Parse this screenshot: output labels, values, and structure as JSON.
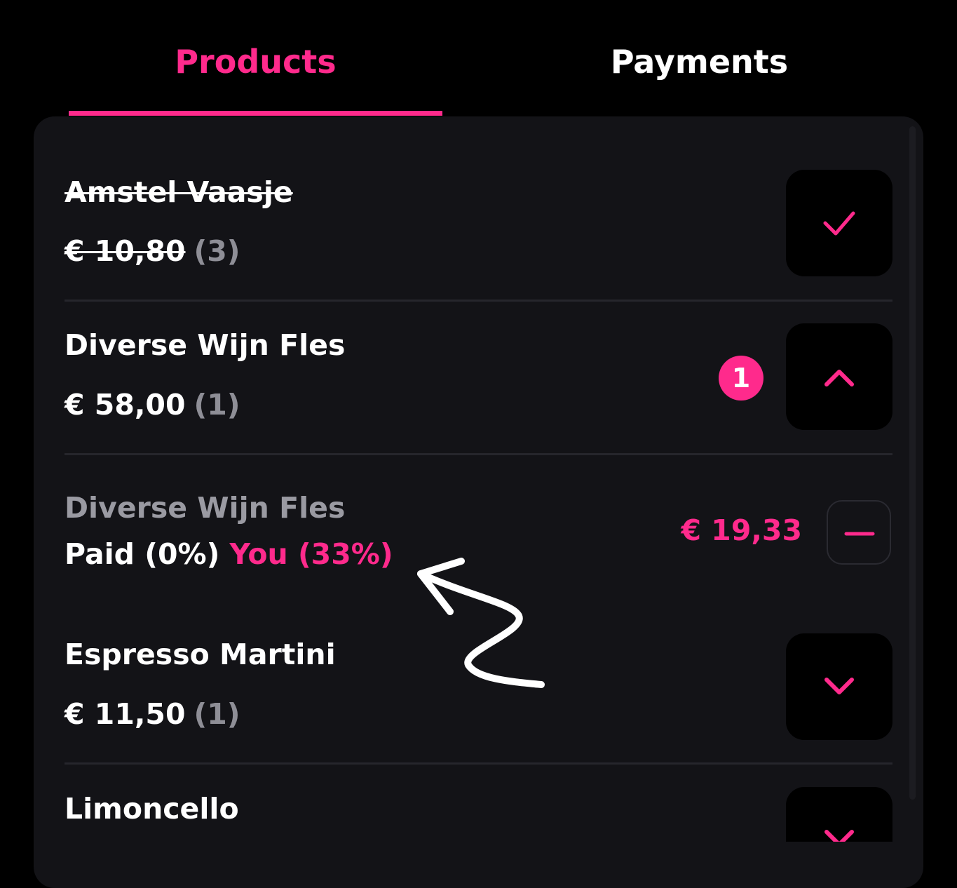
{
  "tabs": {
    "products_label": "Products",
    "payments_label": "Payments",
    "active": "Products"
  },
  "colors": {
    "accent": "#ff2a8c",
    "background": "#000000",
    "panel": "#131317",
    "muted_text": "#8e8e96"
  },
  "products": [
    {
      "name": "Amstel Vaasje",
      "price": "€ 10,80",
      "qty": "(3)",
      "state": "completed",
      "action_icon": "check-icon"
    },
    {
      "name": "Diverse Wijn Fles",
      "price": "€ 58,00",
      "qty": "(1)",
      "state": "expanded",
      "badge": "1",
      "action_icon": "chevron-up-icon",
      "split": {
        "name": "Diverse Wijn Fles",
        "paid": "Paid (0%)",
        "you": "You (33%)",
        "amount": "€ 19,33",
        "action_icon": "minus-icon"
      }
    },
    {
      "name": "Espresso Martini",
      "price": "€ 11,50",
      "qty": "(1)",
      "state": "collapsed",
      "action_icon": "chevron-down-icon"
    },
    {
      "name": "Limoncello",
      "state": "collapsed",
      "action_icon": "chevron-down-icon"
    }
  ]
}
